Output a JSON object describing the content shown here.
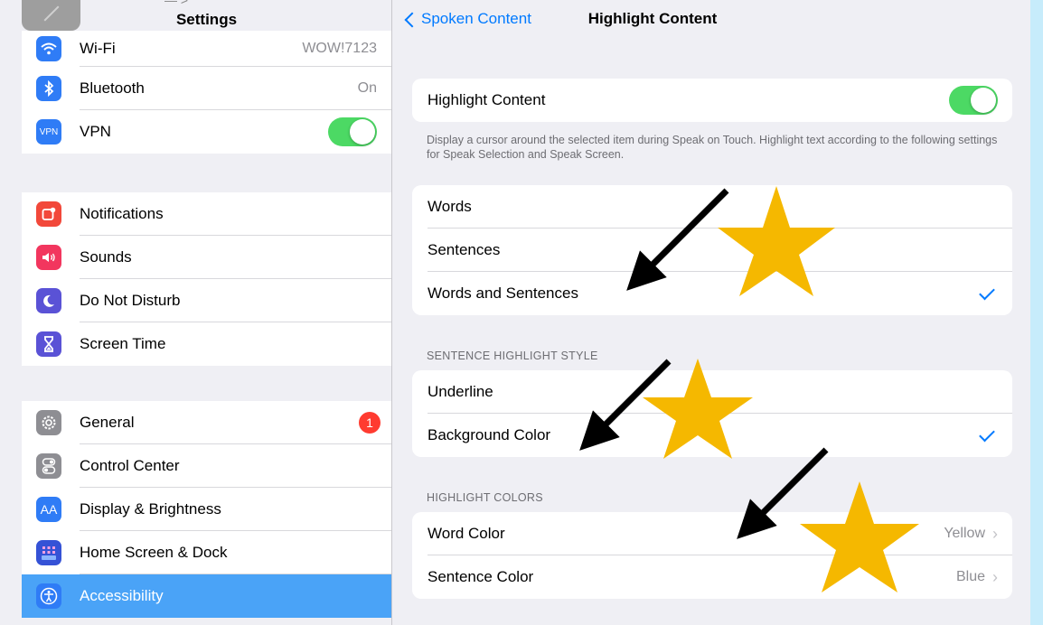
{
  "sidebar": {
    "title": "Settings",
    "peek_text": "— >",
    "group1": [
      {
        "label": "Wi-Fi",
        "value": "WOW!7123",
        "icon": "wifi-icon",
        "color": "#2f7cf6"
      },
      {
        "label": "Bluetooth",
        "value": "On",
        "icon": "bluetooth-icon",
        "color": "#2f7cf6"
      },
      {
        "label": "VPN",
        "icon_text": "VPN",
        "icon": "vpn-icon",
        "color": "#2f7cf6",
        "toggle": true
      }
    ],
    "group2": [
      {
        "label": "Notifications",
        "icon": "notifications-icon",
        "color": "#f2483a"
      },
      {
        "label": "Sounds",
        "icon": "sounds-icon",
        "color": "#f2365e"
      },
      {
        "label": "Do Not Disturb",
        "icon": "moon-icon",
        "color": "#5a52d6"
      },
      {
        "label": "Screen Time",
        "icon": "hourglass-icon",
        "color": "#5a52d6"
      }
    ],
    "group3": [
      {
        "label": "General",
        "icon": "gear-icon",
        "color": "#8e8e93",
        "badge": "1"
      },
      {
        "label": "Control Center",
        "icon": "switches-icon",
        "color": "#8e8e93"
      },
      {
        "label": "Display & Brightness",
        "icon_text": "AA",
        "icon": "display-icon",
        "color": "#2f7cf6"
      },
      {
        "label": "Home Screen & Dock",
        "icon": "grid-icon",
        "color": "#3552d6"
      },
      {
        "label": "Accessibility",
        "icon": "accessibility-icon",
        "color": "#2f7cf6",
        "selected": true
      }
    ]
  },
  "pane": {
    "back_label": "Spoken Content",
    "title": "Highlight Content",
    "highlight_toggle_label": "Highlight Content",
    "footnote": "Display a cursor around the selected item during Speak on Touch. Highlight text according to the following settings for Speak Selection and Speak Screen.",
    "highlight_options": [
      {
        "label": "Words",
        "checked": false
      },
      {
        "label": "Sentences",
        "checked": false
      },
      {
        "label": "Words and Sentences",
        "checked": true
      }
    ],
    "sentence_style_header": "SENTENCE HIGHLIGHT STYLE",
    "sentence_styles": [
      {
        "label": "Underline",
        "checked": false
      },
      {
        "label": "Background Color",
        "checked": true
      }
    ],
    "colors_header": "HIGHLIGHT COLORS",
    "colors": [
      {
        "label": "Word Color",
        "value": "Yellow"
      },
      {
        "label": "Sentence Color",
        "value": "Blue"
      }
    ]
  },
  "colors": {
    "accent": "#007aff",
    "toggle_on": "#4cd964",
    "selected_row": "#4aa3f7",
    "star": "#f5b800",
    "background": "#c7ecfb"
  }
}
